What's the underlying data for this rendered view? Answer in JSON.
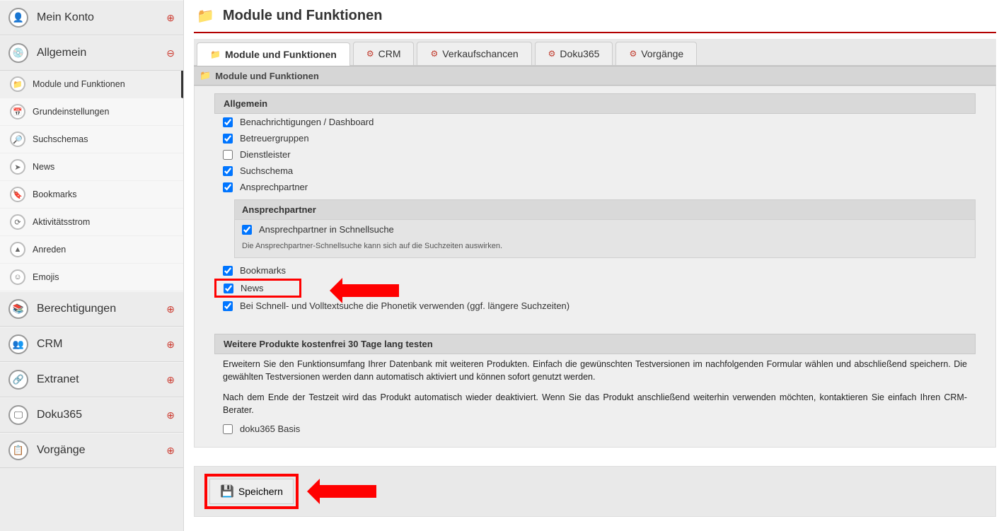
{
  "page_title": "Module und Funktionen",
  "sidebar": {
    "groups": [
      {
        "label": "Mein Konto",
        "glyph": "👤",
        "expanded": false
      },
      {
        "label": "Allgemein",
        "glyph": "💿",
        "expanded": true,
        "items": [
          {
            "label": "Module und Funktionen",
            "glyph": "📁",
            "active": true
          },
          {
            "label": "Grundeinstellungen",
            "glyph": "📅",
            "active": false
          },
          {
            "label": "Suchschemas",
            "glyph": "🔎",
            "active": false
          },
          {
            "label": "News",
            "glyph": "➤",
            "active": false
          },
          {
            "label": "Bookmarks",
            "glyph": "🔖",
            "active": false
          },
          {
            "label": "Aktivitätsstrom",
            "glyph": "⟳",
            "active": false
          },
          {
            "label": "Anreden",
            "glyph": "▲",
            "active": false
          },
          {
            "label": "Emojis",
            "glyph": "☺",
            "active": false
          }
        ]
      },
      {
        "label": "Berechtigungen",
        "glyph": "📚",
        "expanded": false
      },
      {
        "label": "CRM",
        "glyph": "👥",
        "expanded": false
      },
      {
        "label": "Extranet",
        "glyph": "🔗",
        "expanded": false
      },
      {
        "label": "Doku365",
        "glyph": "🖵",
        "expanded": false
      },
      {
        "label": "Vorgänge",
        "glyph": "📋",
        "expanded": false
      }
    ],
    "expand_glyph_open": "⊖",
    "expand_glyph_closed": "⊕"
  },
  "tabs": [
    {
      "label": "Module und Funktionen",
      "glyph": "📁",
      "active": true
    },
    {
      "label": "CRM",
      "glyph": "⚙",
      "active": false
    },
    {
      "label": "Verkaufschancen",
      "glyph": "⚙",
      "active": false
    },
    {
      "label": "Doku365",
      "glyph": "⚙",
      "active": false
    },
    {
      "label": "Vorgänge",
      "glyph": "⚙",
      "active": false
    }
  ],
  "section_header": "Module und Funktionen",
  "allgemein": {
    "header": "Allgemein",
    "items": [
      {
        "label": "Benachrichtigungen / Dashboard",
        "checked": true
      },
      {
        "label": "Betreuergruppen",
        "checked": true
      },
      {
        "label": "Dienstleister",
        "checked": false
      },
      {
        "label": "Suchschema",
        "checked": true
      },
      {
        "label": "Ansprechpartner",
        "checked": true
      }
    ],
    "ansprech": {
      "header": "Ansprechpartner",
      "check": {
        "label": "Ansprechpartner in Schnellsuche",
        "checked": true
      },
      "hint": "Die Ansprechpartner-Schnellsuche kann sich auf die Suchzeiten auswirken."
    },
    "lower": [
      {
        "label": "Bookmarks",
        "checked": true,
        "highlight": false
      },
      {
        "label": "News",
        "checked": true,
        "highlight": true
      },
      {
        "label": "Bei Schnell- und Volltextsuche die Phonetik verwenden (ggf. längere Suchzeiten)",
        "checked": true,
        "highlight": false
      }
    ]
  },
  "weitere": {
    "header": "Weitere Produkte kostenfrei 30 Tage lang testen",
    "p1": "Erweitern Sie den Funktionsumfang Ihrer Datenbank mit weiteren Produkten. Einfach die gewünschten Testversionen im nachfolgenden Formular wählen und abschließend speichern. Die gewählten Testversionen werden dann automatisch aktiviert und können sofort genutzt werden.",
    "p2": "Nach dem Ende der Testzeit wird das Produkt automatisch wieder deaktiviert. Wenn Sie das Produkt anschließend weiterhin verwenden möchten, kontaktieren Sie einfach Ihren CRM-Berater.",
    "check": {
      "label": "doku365 Basis",
      "checked": false
    }
  },
  "save_label": "Speichern"
}
